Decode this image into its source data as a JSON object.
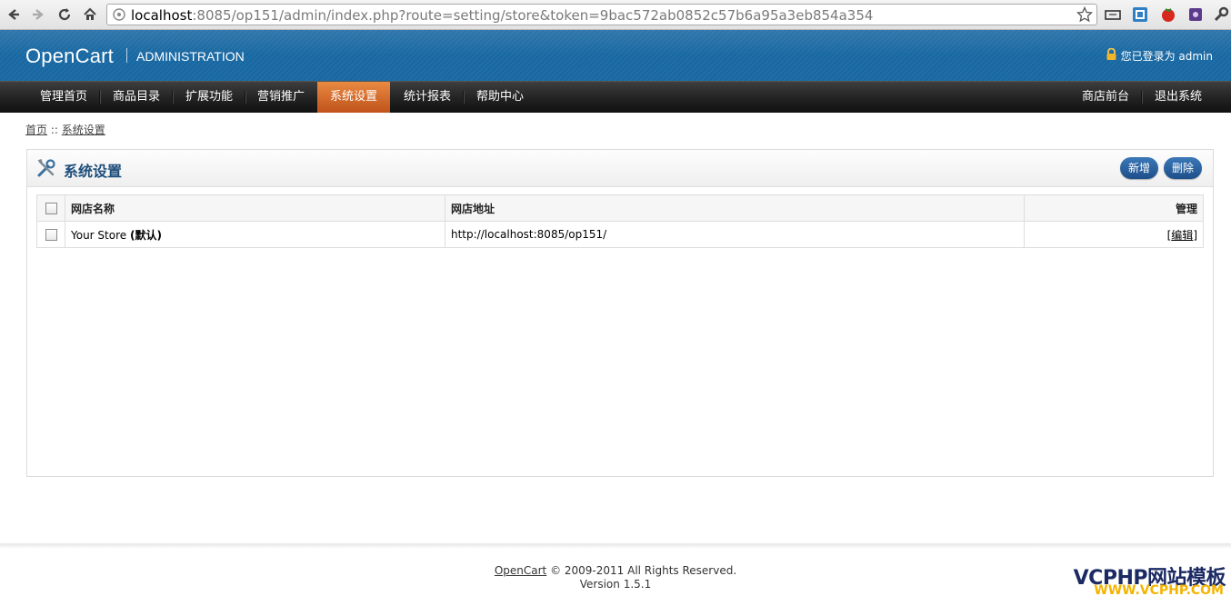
{
  "browser": {
    "url_host": "localhost",
    "url_rest": ":8085/op151/admin/index.php?route=setting/store&token=9bac572ab0852c57b6a95a3eb854a354"
  },
  "header": {
    "logo": "OpenCart",
    "subtitle": "ADMINISTRATION",
    "login_text": "您已登录为 admin"
  },
  "menu": {
    "items": [
      "管理首页",
      "商品目录",
      "扩展功能",
      "营销推广",
      "系统设置",
      "统计报表",
      "帮助中心"
    ],
    "active": "系统设置",
    "right_items": [
      "商店前台",
      "退出系统"
    ]
  },
  "breadcrumb": {
    "home": "首页",
    "separator": " :: ",
    "current": "系统设置"
  },
  "panel": {
    "title": "系统设置",
    "add_button": "新增",
    "delete_button": "删除"
  },
  "table": {
    "columns": [
      "网店名称",
      "网店地址",
      "管理"
    ],
    "rows": [
      {
        "name": "Your Store",
        "default_tag": "(默认)",
        "url": "http://localhost:8085/op151/",
        "action": "编辑"
      }
    ]
  },
  "footer": {
    "link": "OpenCart",
    "copyright": " © 2009-2011 All Rights Reserved.",
    "version": "Version 1.5.1"
  },
  "watermark": {
    "line1": "VCPHP网站模板",
    "line2": "WWW.VCPHP.COM"
  },
  "colors": {
    "header_blue": "#1f6fa8",
    "active_tab": "#d4652a",
    "button_blue": "#2a62a2"
  }
}
